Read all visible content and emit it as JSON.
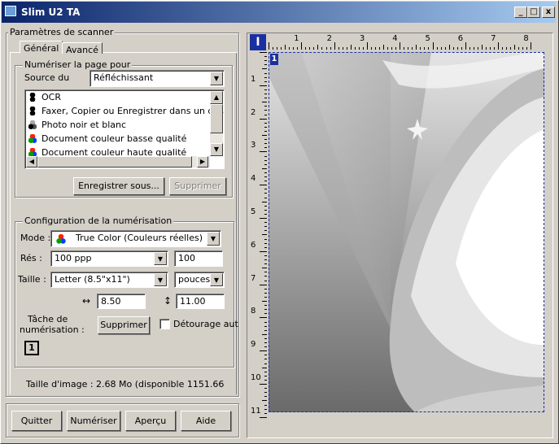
{
  "window": {
    "title": "Slim U2 TA",
    "min": "_",
    "max": "□",
    "close": "x"
  },
  "params_group": "Paramètres de scanner",
  "tabs": [
    "Général",
    "Avancé"
  ],
  "scan_group": "Numériser la page pour",
  "source_label": "Source du",
  "source_value": "Réfléchissant",
  "list": [
    "OCR",
    "Faxer, Copier ou Enregistrer dans un dos:",
    "Photo noir et blanc",
    "Document couleur basse qualité",
    "Document couleur haute qualité"
  ],
  "save_as": "Enregistrer sous...",
  "delete_disabled": "Supprimer",
  "config_group": "Configuration de la numérisation",
  "mode_label": "Mode :",
  "mode_value": "True Color (Couleurs réelles)",
  "res_label": "Rés :",
  "res_value": "100 ppp",
  "res_input": "100",
  "size_label": "Taille :",
  "size_value": "Letter (8.5\"x11\")",
  "unit_value": "pouces",
  "width_value": "8.50",
  "height_value": "11.00",
  "task_label_1": "Tâche de",
  "task_label_2": "numérisation :",
  "task_delete": "Supprimer",
  "crop_label": "Détourage aut",
  "task_badge": "1",
  "image_size": "Taille d'image : 2.68 Mo (disponible 1151.66",
  "buttons": {
    "quit": "Quitter",
    "scan": "Numériser",
    "preview": "Aperçu",
    "help": "Aide"
  },
  "ruler": {
    "h": [
      "1",
      "2",
      "3",
      "4",
      "5",
      "6",
      "7",
      "8"
    ],
    "v": [
      "1",
      "2",
      "3",
      "4",
      "5",
      "6",
      "7",
      "8",
      "9",
      "10",
      "11"
    ],
    "corner": "I",
    "page_badge": "1"
  },
  "colors": {
    "title_start": "#0a246a",
    "title_end": "#a6caf0",
    "face": "#d4d0c8"
  }
}
